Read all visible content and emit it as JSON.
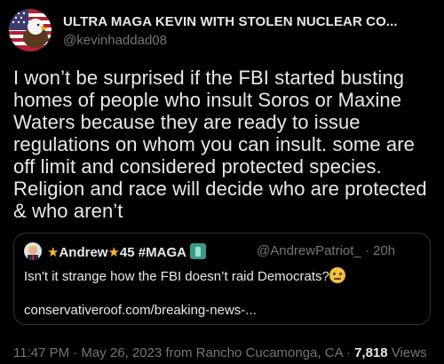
{
  "author": {
    "display_name": "ULTRA MAGA KEVIN WITH STOLEN NUCLEAR CO...",
    "handle": "@kevinhaddad08",
    "avatar_icon": "eagle-flag-avatar-icon"
  },
  "tweet_text": "I won’t be surprised if the FBI started busting homes of people who insult Soros or Maxine Waters because they are ready to issue regulations on whom you can insult. some are off limit and considered protected species. Religion and race will decide who are protected & who aren’t",
  "quote": {
    "name_prefix_star": "★",
    "name_main": "Andrew",
    "name_mid_star": "★",
    "name_suffix": "45 #MAGA",
    "handle": "@AndrewPatriot_",
    "separator": "·",
    "time": "20h",
    "text": "Isn't it strange how the FBI doesn’t raid Democrats?",
    "link": "conservativeroof.com/breaking-news-..."
  },
  "footer": {
    "time_location": "11:47 PM · May 26, 2023 from Rancho Cucamonga, CA · ",
    "views_count": "7,818",
    "views_label": " Views"
  },
  "colors": {
    "background": "#000000",
    "text": "#e7e9ea",
    "muted": "#71767b",
    "border": "#2f3336"
  }
}
